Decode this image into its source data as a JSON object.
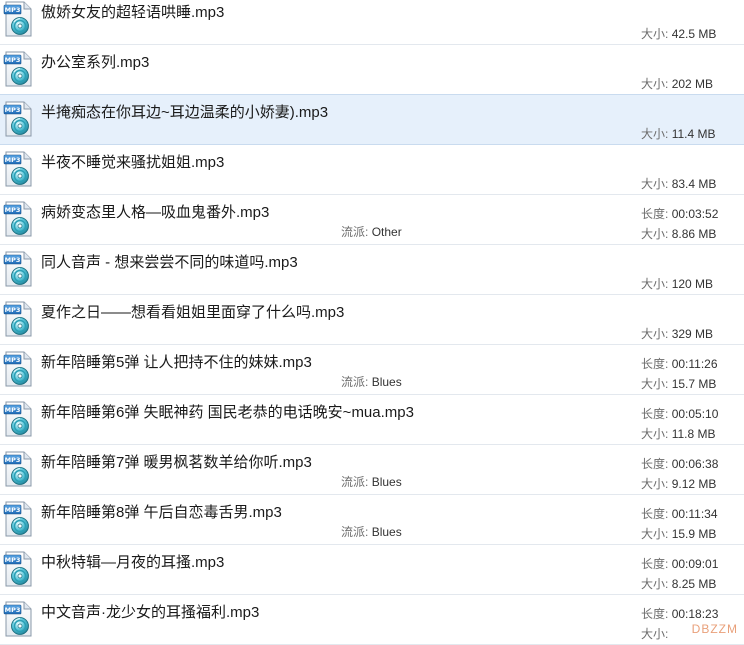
{
  "labels": {
    "size": "大小:",
    "duration": "长度:",
    "genre": "流派:"
  },
  "files": [
    {
      "name": "傲娇女友的超轻语哄睡.mp3",
      "size": "42.5 MB"
    },
    {
      "name": "办公室系列.mp3",
      "size": "202 MB"
    },
    {
      "name": "半掩痴态在你耳边~耳边温柔的小娇妻).mp3",
      "size": "11.4 MB",
      "selected": true
    },
    {
      "name": "半夜不睡觉来骚扰姐姐.mp3",
      "size": "83.4 MB"
    },
    {
      "name": "病娇变态里人格—吸血鬼番外.mp3",
      "duration": "00:03:52",
      "genre": "Other",
      "size": "8.86 MB"
    },
    {
      "name": "同人音声 - 想来尝尝不同的味道吗.mp3",
      "size": "120 MB"
    },
    {
      "name": "夏作之日——想看看姐姐里面穿了什么吗.mp3",
      "size": "329 MB"
    },
    {
      "name": "新年陪睡第5弹 让人把持不住的妹妹.mp3",
      "duration": "00:11:26",
      "genre": "Blues",
      "size": "15.7 MB"
    },
    {
      "name": "新年陪睡第6弹 失眠神药 国民老恭的电话晚安~mua.mp3",
      "duration": "00:05:10",
      "size": "11.8 MB"
    },
    {
      "name": "新年陪睡第7弹 暖男枫茗数羊给你听.mp3",
      "duration": "00:06:38",
      "genre": "Blues",
      "size": "9.12 MB"
    },
    {
      "name": "新年陪睡第8弹 午后自恋毒舌男.mp3",
      "duration": "00:11:34",
      "genre": "Blues",
      "size": "15.9 MB"
    },
    {
      "name": "中秋特辑—月夜的耳搔.mp3",
      "duration": "00:09:01",
      "size": "8.25 MB"
    },
    {
      "name": "中文音声·龙少女的耳搔福利.mp3",
      "duration": "00:18:23",
      "size": ""
    }
  ],
  "watermark": "DBZZM",
  "icon": "mp3-file-icon"
}
